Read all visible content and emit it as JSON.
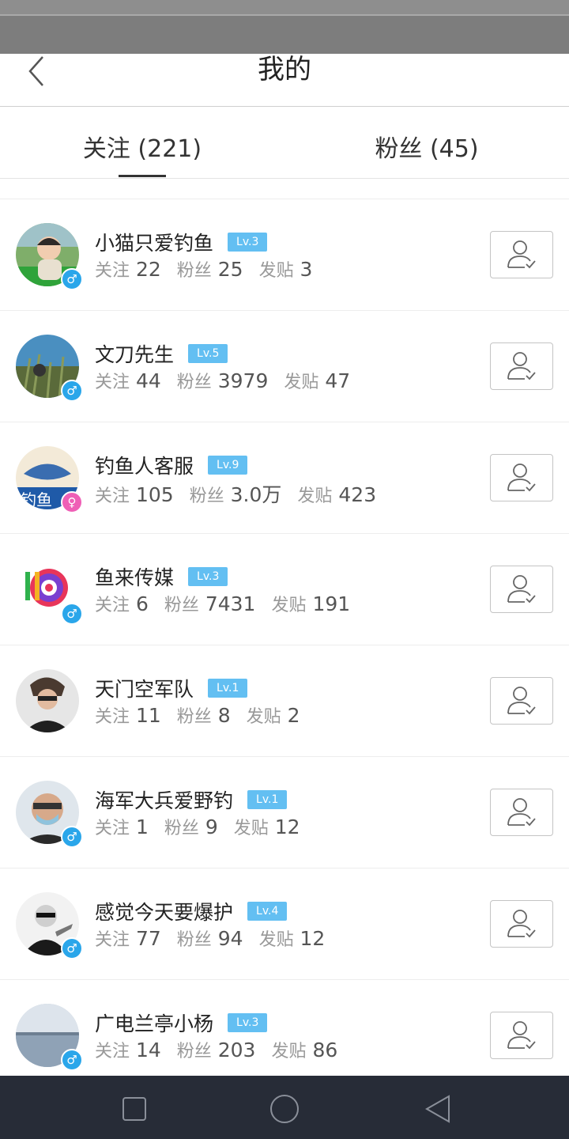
{
  "header": {
    "title": "我的"
  },
  "tabs": [
    {
      "label": "关注 (221)"
    },
    {
      "label": "粉丝 (45)"
    }
  ],
  "labels": {
    "follow": "关注",
    "fans": "粉丝",
    "posts": "发贴"
  },
  "users": [
    {
      "name": "小猫只爱钓鱼",
      "level": "Lv.3",
      "gender": "♂",
      "follow": "22",
      "fans": "25",
      "posts": "3"
    },
    {
      "name": "文刀先生",
      "level": "Lv.5",
      "gender": "♂",
      "follow": "44",
      "fans": "3979",
      "posts": "47"
    },
    {
      "name": "钓鱼人客服",
      "level": "Lv.9",
      "gender": "♀",
      "follow": "105",
      "fans": "3.0万",
      "posts": "423"
    },
    {
      "name": "鱼来传媒",
      "level": "Lv.3",
      "gender": "♂",
      "follow": "6",
      "fans": "7431",
      "posts": "191"
    },
    {
      "name": "天门空军队",
      "level": "Lv.1",
      "gender": "",
      "follow": "11",
      "fans": "8",
      "posts": "2"
    },
    {
      "name": "海军大兵爱野钓",
      "level": "Lv.1",
      "gender": "♂",
      "follow": "1",
      "fans": "9",
      "posts": "12"
    },
    {
      "name": "感觉今天要爆护",
      "level": "Lv.4",
      "gender": "♂",
      "follow": "77",
      "fans": "94",
      "posts": "12"
    },
    {
      "name": "广电兰亭小杨",
      "level": "Lv.3",
      "gender": "♂",
      "follow": "14",
      "fans": "203",
      "posts": "86"
    }
  ],
  "avatar_text": {
    "u3": "钓鱼"
  },
  "colors": {
    "level_badge": "#63bff2",
    "male": "#2aa6ea",
    "female": "#ef5fb6",
    "navbar": "#272c37"
  },
  "icons": {
    "back": "chevron-left-icon",
    "follow_state": "user-check-icon",
    "nav": [
      "square-recent-icon",
      "circle-home-icon",
      "triangle-back-icon"
    ]
  }
}
